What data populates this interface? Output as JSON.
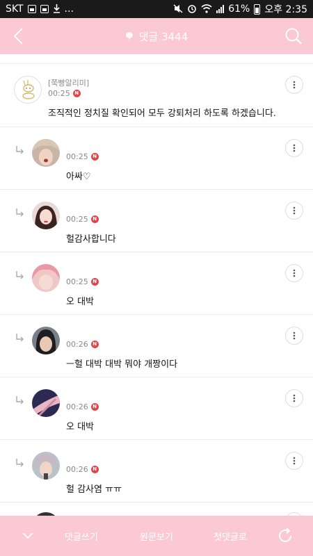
{
  "status_bar": {
    "carrier": "SKT",
    "notification_extra": "...",
    "battery_percent": "61%",
    "time": "오후 2:35"
  },
  "header": {
    "title": "댓글 3444",
    "icons": {
      "back": "chevron-left-icon",
      "search": "search-icon",
      "comment": "comment-bubble-icon"
    }
  },
  "comments": [
    {
      "author": "[쭉빵알리미]",
      "time": "00:25",
      "badge": "N",
      "text": "조직적인 정치질 확인되어 모두 강퇴처리 하도록 하겠습니다."
    },
    {
      "time": "00:25",
      "badge": "N",
      "text": "아싸♡"
    },
    {
      "time": "00:25",
      "badge": "N",
      "text": "헐감사합니다"
    },
    {
      "time": "00:25",
      "badge": "N",
      "text": "오 대박"
    },
    {
      "time": "00:26",
      "badge": "N",
      "text": "ㅡ헐 대박 대박 뭐야 개짱이다"
    },
    {
      "time": "00:26",
      "badge": "N",
      "text": "오 대박"
    },
    {
      "time": "00:26",
      "badge": "N",
      "text": "헐 감사염 ㅠㅠ"
    }
  ],
  "bottom_bar": {
    "write": "댓글쓰기",
    "original": "원문보기",
    "first": "첫댓글로"
  },
  "colors": {
    "header_pink": "#fbc9d4",
    "badge_red": "#e0464b",
    "status_bar": "#1a1a1a"
  }
}
